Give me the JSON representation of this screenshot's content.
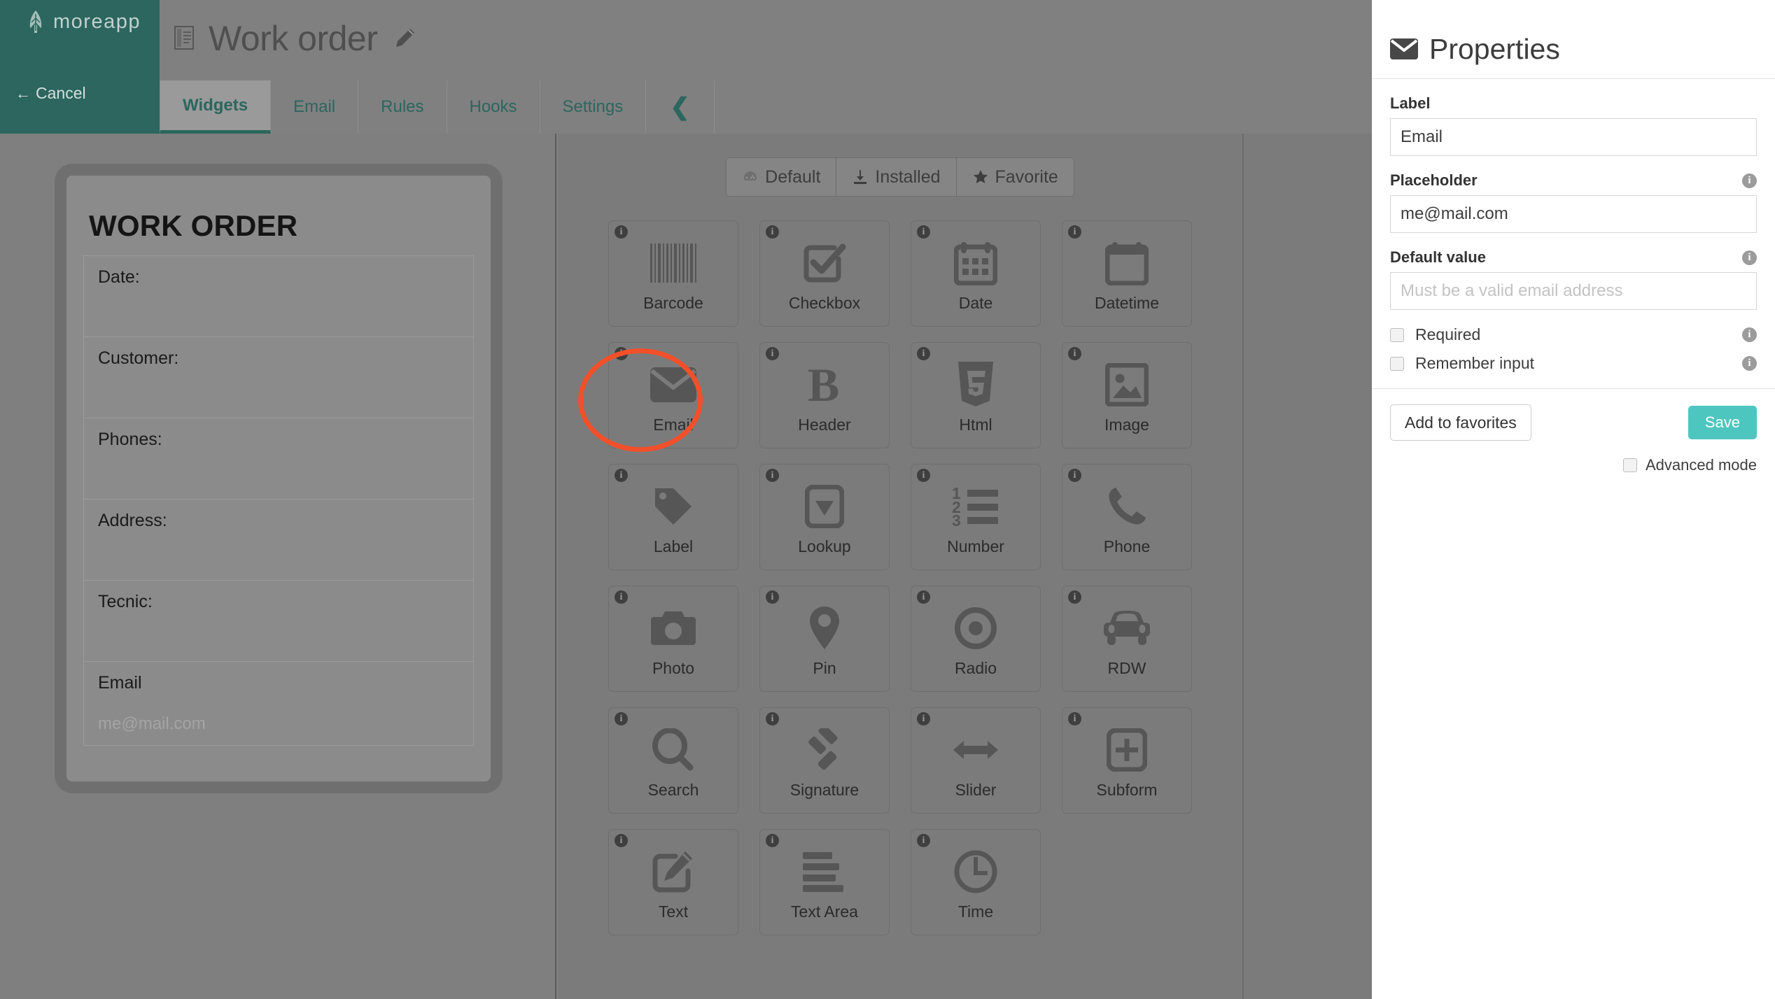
{
  "brand": {
    "name": "moreapp",
    "logo_icon": "leaf-icon",
    "cancel_label": "Cancel",
    "cancel_icon": "arrow-left-icon",
    "bg_color": "#2c665e"
  },
  "header": {
    "doc_icon": "document-icon",
    "form_title": "Work order",
    "edit_icon": "pencil-icon"
  },
  "tabs": [
    {
      "label": "Widgets",
      "active": true
    },
    {
      "label": "Email",
      "active": false
    },
    {
      "label": "Rules",
      "active": false
    },
    {
      "label": "Hooks",
      "active": false
    },
    {
      "label": "Settings",
      "active": false
    }
  ],
  "tab_collapse_icon": "chevron-left-icon",
  "preview": {
    "heading": "WORK ORDER",
    "fields": [
      {
        "label": "Date:",
        "placeholder": ""
      },
      {
        "label": "Customer:",
        "placeholder": ""
      },
      {
        "label": "Phones:",
        "placeholder": ""
      },
      {
        "label": "Address:",
        "placeholder": ""
      },
      {
        "label": "Tecnic:",
        "placeholder": ""
      },
      {
        "label": "Email",
        "placeholder": "me@mail.com"
      }
    ]
  },
  "widget_picker": {
    "filters": [
      {
        "label": "Default",
        "icon": "dashboard-icon",
        "active": false
      },
      {
        "label": "Installed",
        "icon": "download-icon",
        "active": false
      },
      {
        "label": "Favorite",
        "icon": "star-icon",
        "active": false
      }
    ],
    "info_glyph": "i",
    "widgets": [
      {
        "label": "Barcode",
        "icon": "barcode-icon"
      },
      {
        "label": "Checkbox",
        "icon": "checkbox-icon"
      },
      {
        "label": "Date",
        "icon": "calendar-icon"
      },
      {
        "label": "Datetime",
        "icon": "calendar-blank-icon"
      },
      {
        "label": "Email",
        "icon": "envelope-icon",
        "highlighted": true
      },
      {
        "label": "Header",
        "icon": "bold-b-icon"
      },
      {
        "label": "Html",
        "icon": "html5-icon"
      },
      {
        "label": "Image",
        "icon": "image-icon"
      },
      {
        "label": "Label",
        "icon": "tag-icon"
      },
      {
        "label": "Lookup",
        "icon": "dropdown-icon"
      },
      {
        "label": "Number",
        "icon": "numbered-list-icon"
      },
      {
        "label": "Phone",
        "icon": "phone-icon"
      },
      {
        "label": "Photo",
        "icon": "camera-icon"
      },
      {
        "label": "Pin",
        "icon": "map-pin-icon"
      },
      {
        "label": "Radio",
        "icon": "radio-icon"
      },
      {
        "label": "RDW",
        "icon": "car-icon"
      },
      {
        "label": "Search",
        "icon": "magnifier-icon"
      },
      {
        "label": "Signature",
        "icon": "gavel-icon"
      },
      {
        "label": "Slider",
        "icon": "arrows-horizontal-icon"
      },
      {
        "label": "Subform",
        "icon": "plus-box-icon"
      },
      {
        "label": "Text",
        "icon": "pencil-box-icon"
      },
      {
        "label": "Text Area",
        "icon": "lines-icon"
      },
      {
        "label": "Time",
        "icon": "clock-icon"
      }
    ],
    "highlight_color": "#f2502a"
  },
  "properties": {
    "title": "Properties",
    "title_icon": "envelope-icon",
    "fields": [
      {
        "label": "Label",
        "value": "Email",
        "placeholder": "",
        "has_info": false
      },
      {
        "label": "Placeholder",
        "value": "me@mail.com",
        "placeholder": "",
        "has_info": true
      },
      {
        "label": "Default value",
        "value": "",
        "placeholder": "Must be a valid email address",
        "has_info": true
      }
    ],
    "checkboxes": [
      {
        "label": "Required",
        "checked": false,
        "has_info": true
      },
      {
        "label": "Remember input",
        "checked": false,
        "has_info": true
      }
    ],
    "favorites_button": "Add to favorites",
    "save_button": "Save",
    "save_color": "#4ec6c0",
    "advanced_mode": {
      "label": "Advanced mode",
      "checked": false
    }
  }
}
